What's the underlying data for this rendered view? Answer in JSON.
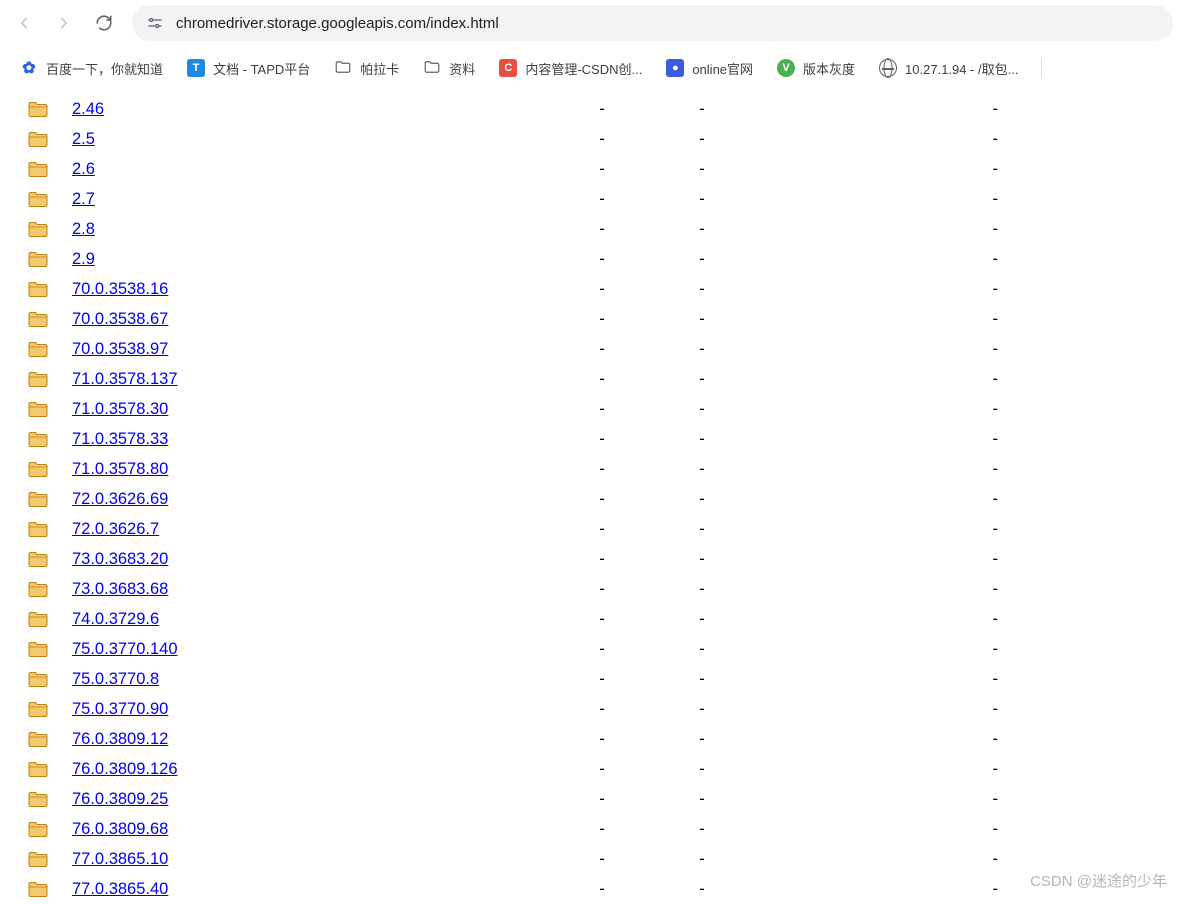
{
  "toolbar": {
    "url": "chromedriver.storage.googleapis.com/index.html"
  },
  "bookmarks": [
    {
      "label": "百度一下，你就知道",
      "fav": "baidu"
    },
    {
      "label": "文档 - TAPD平台",
      "fav": "tapd"
    },
    {
      "label": "帕拉卡",
      "fav": "folder"
    },
    {
      "label": "资料",
      "fav": "folder"
    },
    {
      "label": "内容管理-CSDN创...",
      "fav": "csdn"
    },
    {
      "label": "online官网",
      "fav": "online"
    },
    {
      "label": "版本灰度",
      "fav": "ver"
    },
    {
      "label": "10.27.1.94 - /取包...",
      "fav": "ip"
    }
  ],
  "rows": [
    {
      "name": "2.46",
      "c1": "-",
      "c2": "-",
      "c3": "-"
    },
    {
      "name": "2.5",
      "c1": "-",
      "c2": "-",
      "c3": "-"
    },
    {
      "name": "2.6",
      "c1": "-",
      "c2": "-",
      "c3": "-"
    },
    {
      "name": "2.7",
      "c1": "-",
      "c2": "-",
      "c3": "-"
    },
    {
      "name": "2.8",
      "c1": "-",
      "c2": "-",
      "c3": "-"
    },
    {
      "name": "2.9",
      "c1": "-",
      "c2": "-",
      "c3": "-"
    },
    {
      "name": "70.0.3538.16",
      "c1": "-",
      "c2": "-",
      "c3": "-"
    },
    {
      "name": "70.0.3538.67",
      "c1": "-",
      "c2": "-",
      "c3": "-"
    },
    {
      "name": "70.0.3538.97",
      "c1": "-",
      "c2": "-",
      "c3": "-"
    },
    {
      "name": "71.0.3578.137",
      "c1": "-",
      "c2": "-",
      "c3": "-"
    },
    {
      "name": "71.0.3578.30",
      "c1": "-",
      "c2": "-",
      "c3": "-"
    },
    {
      "name": "71.0.3578.33",
      "c1": "-",
      "c2": "-",
      "c3": "-"
    },
    {
      "name": "71.0.3578.80",
      "c1": "-",
      "c2": "-",
      "c3": "-"
    },
    {
      "name": "72.0.3626.69",
      "c1": "-",
      "c2": "-",
      "c3": "-"
    },
    {
      "name": "72.0.3626.7",
      "c1": "-",
      "c2": "-",
      "c3": "-"
    },
    {
      "name": "73.0.3683.20",
      "c1": "-",
      "c2": "-",
      "c3": "-"
    },
    {
      "name": "73.0.3683.68",
      "c1": "-",
      "c2": "-",
      "c3": "-"
    },
    {
      "name": "74.0.3729.6",
      "c1": "-",
      "c2": "-",
      "c3": "-"
    },
    {
      "name": "75.0.3770.140",
      "c1": "-",
      "c2": "-",
      "c3": "-"
    },
    {
      "name": "75.0.3770.8",
      "c1": "-",
      "c2": "-",
      "c3": "-"
    },
    {
      "name": "75.0.3770.90",
      "c1": "-",
      "c2": "-",
      "c3": "-"
    },
    {
      "name": "76.0.3809.12",
      "c1": "-",
      "c2": "-",
      "c3": "-"
    },
    {
      "name": "76.0.3809.126",
      "c1": "-",
      "c2": "-",
      "c3": "-"
    },
    {
      "name": "76.0.3809.25",
      "c1": "-",
      "c2": "-",
      "c3": "-"
    },
    {
      "name": "76.0.3809.68",
      "c1": "-",
      "c2": "-",
      "c3": "-"
    },
    {
      "name": "77.0.3865.10",
      "c1": "-",
      "c2": "-",
      "c3": "-"
    },
    {
      "name": "77.0.3865.40",
      "c1": "-",
      "c2": "-",
      "c3": "-"
    }
  ],
  "watermark": "CSDN @迷途的少年"
}
